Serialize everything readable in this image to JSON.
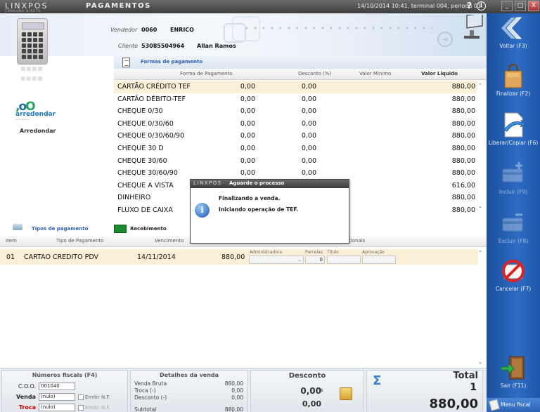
{
  "titlebar": {
    "logo": "LINXPOS",
    "logo_sub": "CONSUMO DIRETO",
    "title": "Pagamentos",
    "status": "14/10/2014 10:41, terminal 004, periodo 01.",
    "help": "?",
    "info": "i",
    "minimize": "_",
    "maximize": "□",
    "close": "X"
  },
  "header": {
    "vendedor_label": "Vendedor",
    "vendedor_code": "0060",
    "vendedor_name": "ENRICO",
    "cliente_label": "Cliente",
    "cliente_code": "53085504964",
    "cliente_name": "Allan Ramos"
  },
  "arredondar": {
    "logo_text": "arredondar",
    "logo_sub": "eu arredondo",
    "label": "Arredondar"
  },
  "forms_tab": {
    "label": "Formas de pagamento"
  },
  "formas_table": {
    "columns": [
      "Forma de Pagamento",
      "Desconto (%)",
      "Valor Mínimo",
      "Valor Líquido"
    ],
    "rows": [
      {
        "nome": "CARTÃO CRÉDITO TEF",
        "desconto": "0,00",
        "minimo": "0,00",
        "liquido": "880,00"
      },
      {
        "nome": "CARTÃO DÉBITO-TEF",
        "desconto": "0,00",
        "minimo": "0,00",
        "liquido": "880,00"
      },
      {
        "nome": "CHEQUE 0/30",
        "desconto": "0,00",
        "minimo": "0,00",
        "liquido": "880,00"
      },
      {
        "nome": "CHEQUE 0/30/60",
        "desconto": "0,00",
        "minimo": "0,00",
        "liquido": "880,00"
      },
      {
        "nome": "CHEQUE 0/30/60/90",
        "desconto": "0,00",
        "minimo": "0,00",
        "liquido": "880,00"
      },
      {
        "nome": "CHEQUE 30 D",
        "desconto": "0,00",
        "minimo": "0,00",
        "liquido": "880,00"
      },
      {
        "nome": "CHEQUE 30/60",
        "desconto": "0,00",
        "minimo": "0,00",
        "liquido": "880,00"
      },
      {
        "nome": "CHEQUE 30/60/90",
        "desconto": "0,00",
        "minimo": "0,00",
        "liquido": "880,00"
      },
      {
        "nome": "CHEQUE A VISTA",
        "desconto": "0,00",
        "minimo": "0,00",
        "liquido": "616,00"
      },
      {
        "nome": "DINHEIRO",
        "desconto": "",
        "minimo": "0,00",
        "liquido": "880,00"
      },
      {
        "nome": "FLUXO DE CAIXA",
        "desconto": "",
        "minimo": "0,00",
        "liquido": "880,00"
      }
    ],
    "scroll_up": "⌃",
    "scroll_down": "⌄"
  },
  "tipos_bar": {
    "tipos_label": "Tipos de pagamento",
    "recebimento_label": "Recebimento"
  },
  "pagamentos_table": {
    "columns": [
      "Item",
      "Tipo de Pagamento",
      "Vencimento",
      "Dados adicionais"
    ],
    "row": {
      "item": "01",
      "tipo": "CARTAO CREDITO PDV",
      "vencimento": "14/11/2014",
      "valor": "880,00",
      "parcelas": "0"
    },
    "sub_labels": {
      "administradora": "Administradora",
      "parcelas": "Parcelas",
      "titulo": "Título",
      "aprovacao": "Aprovação"
    }
  },
  "numeros_fiscais": {
    "title": "Números fiscais (F4)",
    "coo_label": "C.O.O.",
    "coo_value": "001040",
    "venda_label": "Venda",
    "venda_value": "(nulo)",
    "troca_label": "Troca",
    "troca_value": "(nulo)",
    "emitir_nf": "Emitir N.F.",
    "emitir_nf2": "Emitir N.F."
  },
  "detalhes_venda": {
    "title": "Detalhes da venda",
    "venda_bruta_label": "Venda Bruta",
    "venda_bruta": "880,00",
    "troca_label": "Troca (-)",
    "troca": "0,00",
    "desconto_label": "Desconto (-)",
    "desconto": "0,00",
    "subtotal_label": "Subtotal",
    "subtotal": "880,00"
  },
  "desconto_panel": {
    "title": "Desconto",
    "pct_value": "0,00",
    "pct_sign": "%",
    "value": "0,00"
  },
  "total_panel": {
    "title": "Total",
    "sigma": "Σ",
    "quantity": "1",
    "value": "880,00"
  },
  "sidebar": {
    "items": [
      {
        "label": "Voltar (F3)",
        "icon": "back-arrow-icon",
        "enabled": true
      },
      {
        "label": "Finalizar (F2)",
        "icon": "shopping-bag-icon",
        "enabled": true
      },
      {
        "label": "Liberar/Copiar (F6)",
        "icon": "document-arrow-icon",
        "enabled": true
      },
      {
        "label": "Incluir (F9)",
        "icon": "card-add-icon",
        "enabled": false
      },
      {
        "label": "Excluir (F8)",
        "icon": "card-remove-icon",
        "enabled": false
      },
      {
        "label": "Cancelar (F7)",
        "icon": "cancel-icon",
        "enabled": true
      },
      {
        "label": "Sair (F11)",
        "icon": "exit-door-icon",
        "enabled": true
      }
    ],
    "menu_fiscal": "Menu fiscal"
  },
  "dialog": {
    "logo": "LINXPOS",
    "title": "Aguarde o processo",
    "message1": "Finalizando a venda.",
    "message2": "Iniciando operação de TEF."
  },
  "colors": {
    "sidebar": "#2d6cc4",
    "selected_row": "#faf0d8",
    "link_blue": "#2a5ea8",
    "recebimento_green": "#1d8a2e"
  }
}
